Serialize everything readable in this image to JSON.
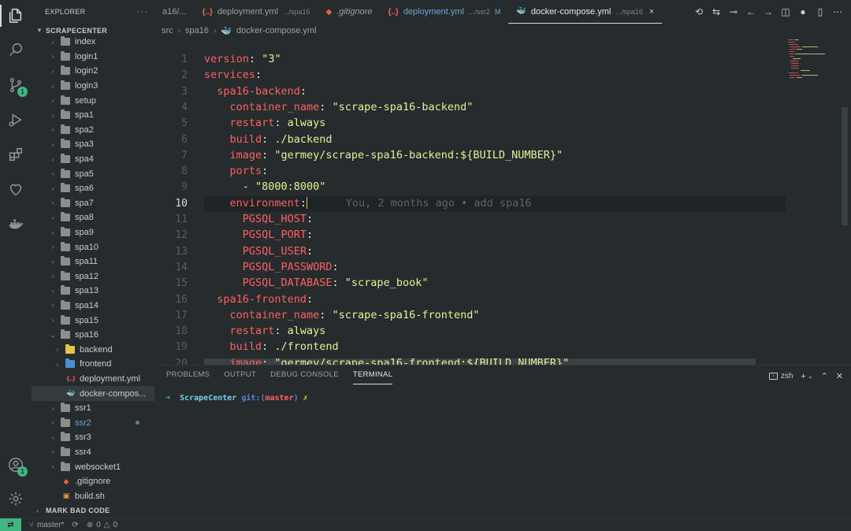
{
  "explorer": {
    "title": "EXPLORER",
    "more": "···",
    "root": "SCRAPECENTER",
    "items": [
      {
        "label": "index",
        "type": "folder",
        "depth": 1
      },
      {
        "label": "login1",
        "type": "folder",
        "depth": 1
      },
      {
        "label": "login2",
        "type": "folder",
        "depth": 1
      },
      {
        "label": "login3",
        "type": "folder",
        "depth": 1
      },
      {
        "label": "setup",
        "type": "folder",
        "depth": 1
      },
      {
        "label": "spa1",
        "type": "folder",
        "depth": 1
      },
      {
        "label": "spa2",
        "type": "folder",
        "depth": 1
      },
      {
        "label": "spa3",
        "type": "folder",
        "depth": 1
      },
      {
        "label": "spa4",
        "type": "folder",
        "depth": 1
      },
      {
        "label": "spa5",
        "type": "folder",
        "depth": 1
      },
      {
        "label": "spa6",
        "type": "folder",
        "depth": 1
      },
      {
        "label": "spa7",
        "type": "folder",
        "depth": 1
      },
      {
        "label": "spa8",
        "type": "folder",
        "depth": 1
      },
      {
        "label": "spa9",
        "type": "folder",
        "depth": 1
      },
      {
        "label": "spa10",
        "type": "folder",
        "depth": 1
      },
      {
        "label": "spa11",
        "type": "folder",
        "depth": 1
      },
      {
        "label": "spa12",
        "type": "folder",
        "depth": 1
      },
      {
        "label": "spa13",
        "type": "folder",
        "depth": 1
      },
      {
        "label": "spa14",
        "type": "folder",
        "depth": 1
      },
      {
        "label": "spa15",
        "type": "folder",
        "depth": 1
      },
      {
        "label": "spa16",
        "type": "folder-open",
        "depth": 1
      },
      {
        "label": "backend",
        "type": "folder-yellow",
        "depth": 2
      },
      {
        "label": "frontend",
        "type": "folder-blue",
        "depth": 2
      },
      {
        "label": "deployment.yml",
        "type": "yml",
        "depth": 2
      },
      {
        "label": "docker-compos...",
        "type": "docker",
        "depth": 2,
        "selected": true
      },
      {
        "label": "ssr1",
        "type": "folder",
        "depth": 1
      },
      {
        "label": "ssr2",
        "type": "folder",
        "depth": 1,
        "modified": true
      },
      {
        "label": "ssr3",
        "type": "folder",
        "depth": 1
      },
      {
        "label": "ssr4",
        "type": "folder",
        "depth": 1
      },
      {
        "label": "websocket1",
        "type": "folder",
        "depth": 1
      },
      {
        "label": ".gitignore",
        "type": "git",
        "depth": 1
      },
      {
        "label": "build.sh",
        "type": "sh",
        "depth": 1
      }
    ],
    "mark_bad_code": "MARK BAD CODE"
  },
  "activity": {
    "scm_badge": "1",
    "account_badge": "1"
  },
  "tabs": [
    {
      "label": "a16/...",
      "icon": "",
      "desc": "",
      "active": false,
      "modified": false
    },
    {
      "label": "deployment.yml",
      "icon": "{..}",
      "desc": ".../spa16",
      "active": false,
      "modified": false
    },
    {
      "label": ".gitignore",
      "icon": "◆",
      "desc": "",
      "active": false,
      "modified": false
    },
    {
      "label": "deployment.yml",
      "icon": "{..}",
      "desc": ".../ssr2",
      "active": false,
      "modified": true,
      "flag": "M"
    },
    {
      "label": "docker-compose.yml",
      "icon": "🐳",
      "desc": ".../spa16",
      "active": true,
      "modified": false,
      "close": "×"
    }
  ],
  "breadcrumb": {
    "parts": [
      "src",
      "spa16",
      "docker-compose.yml"
    ],
    "sep": "›"
  },
  "editor": {
    "current_line": 10,
    "blame": "You, 2 months ago • add spa16",
    "lines": [
      {
        "n": "1",
        "indent": 0,
        "key": "version",
        "val": "\"3\""
      },
      {
        "n": "2",
        "indent": 0,
        "key": "services",
        "val": ""
      },
      {
        "n": "3",
        "indent": 1,
        "key": "spa16-backend",
        "val": ""
      },
      {
        "n": "4",
        "indent": 2,
        "key": "container_name",
        "val": "\"scrape-spa16-backend\""
      },
      {
        "n": "5",
        "indent": 2,
        "key": "restart",
        "val": "always"
      },
      {
        "n": "6",
        "indent": 2,
        "key": "build",
        "val": "./backend"
      },
      {
        "n": "7",
        "indent": 2,
        "key": "image",
        "val": "\"germey/scrape-spa16-backend:${BUILD_NUMBER}\""
      },
      {
        "n": "8",
        "indent": 2,
        "key": "ports",
        "val": ""
      },
      {
        "n": "9",
        "indent": 3,
        "key": "",
        "val": "\"8000:8000\"",
        "dash": true
      },
      {
        "n": "10",
        "indent": 2,
        "key": "environment",
        "val": ""
      },
      {
        "n": "11",
        "indent": 3,
        "key": "PGSQL_HOST",
        "val": ""
      },
      {
        "n": "12",
        "indent": 3,
        "key": "PGSQL_PORT",
        "val": ""
      },
      {
        "n": "13",
        "indent": 3,
        "key": "PGSQL_USER",
        "val": ""
      },
      {
        "n": "14",
        "indent": 3,
        "key": "PGSQL_PASSWORD",
        "val": ""
      },
      {
        "n": "15",
        "indent": 3,
        "key": "PGSQL_DATABASE",
        "val": "\"scrape_book\""
      },
      {
        "n": "16",
        "indent": 1,
        "key": "spa16-frontend",
        "val": ""
      },
      {
        "n": "17",
        "indent": 2,
        "key": "container_name",
        "val": "\"scrape-spa16-frontend\""
      },
      {
        "n": "18",
        "indent": 2,
        "key": "restart",
        "val": "always"
      },
      {
        "n": "19",
        "indent": 2,
        "key": "build",
        "val": "./frontend"
      },
      {
        "n": "20",
        "indent": 2,
        "key": "image",
        "val": "\"germey/scrape-spa16-frontend:${BUILD_NUMBER}\""
      }
    ]
  },
  "panel": {
    "tabs": [
      "PROBLEMS",
      "OUTPUT",
      "DEBUG CONSOLE",
      "TERMINAL"
    ],
    "active_tab": "TERMINAL",
    "shell": "zsh",
    "terminal": {
      "arrow": "➜",
      "dir": "ScrapeCenter",
      "git": "git:(",
      "branch": "master",
      "git_close": ")",
      "dirty": "✗"
    }
  },
  "statusbar": {
    "remote": "⇄",
    "branch": "master*",
    "sync": "⟳",
    "errors": "0",
    "warnings": "0"
  }
}
